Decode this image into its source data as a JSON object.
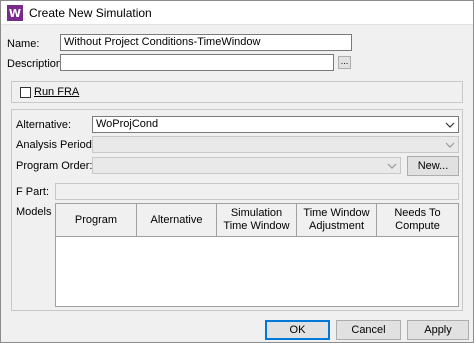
{
  "window": {
    "title": "Create New Simulation"
  },
  "form": {
    "name_label": "Name:",
    "name_value": "Without Project Conditions-TimeWindow",
    "description_label": "Description:",
    "description_value": "",
    "browse_label": "..."
  },
  "fra": {
    "checkbox_label": "Run FRA",
    "checked": false
  },
  "settings": {
    "alternative_label": "Alternative:",
    "alternative_value": "WoProjCond",
    "analysis_period_label": "Analysis Period:",
    "analysis_period_value": "",
    "program_order_label": "Program Order:",
    "program_order_value": "",
    "new_button": "New...",
    "fpart_label": "F Part:",
    "fpart_value": "",
    "models_label": "Models"
  },
  "models_table": {
    "columns": [
      "Program",
      "Alternative",
      "Simulation\nTime Window",
      "Time Window\nAdjustment",
      "Needs To\nCompute"
    ],
    "rows": []
  },
  "buttons": {
    "ok": "OK",
    "cancel": "Cancel",
    "apply": "Apply"
  }
}
